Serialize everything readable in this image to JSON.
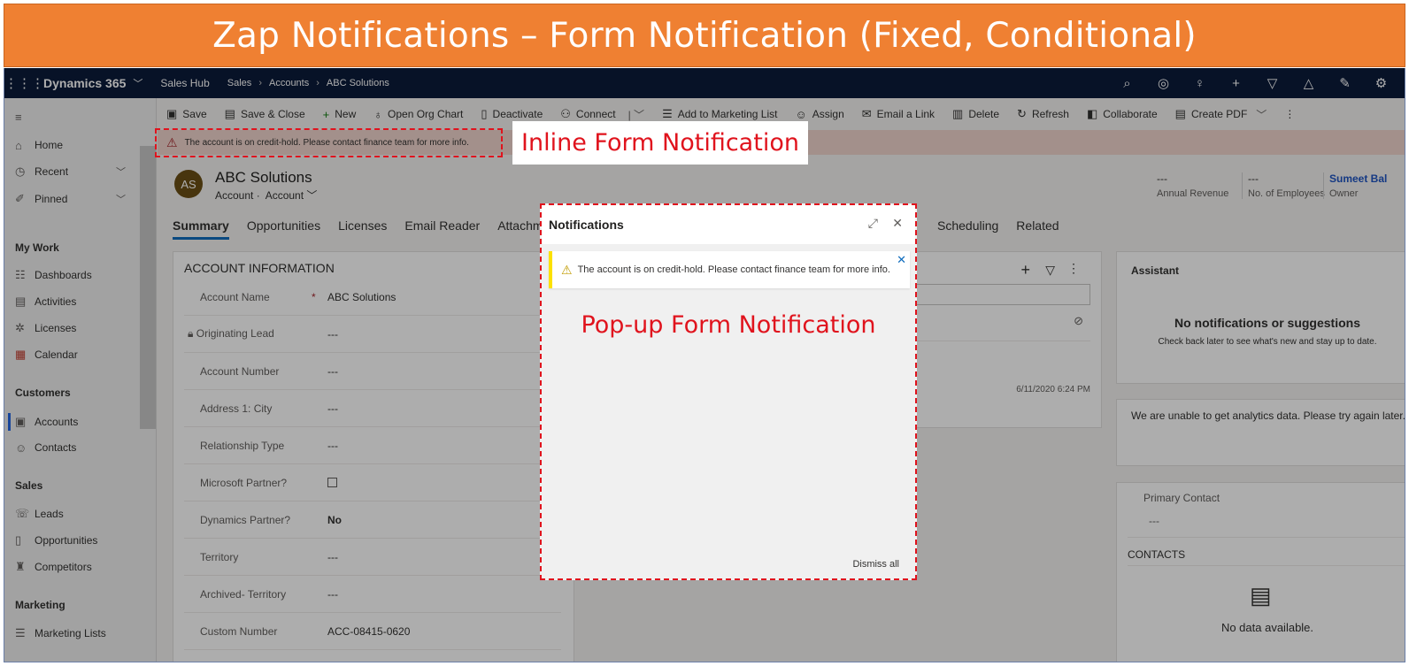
{
  "banner": {
    "title": "Zap Notifications –  Form Notification (Fixed, Conditional)"
  },
  "topbar": {
    "brand": "Dynamics 365",
    "app": "Sales Hub",
    "breadcrumb": [
      "Sales",
      "Accounts",
      "ABC Solutions"
    ]
  },
  "sidebar": {
    "home": "Home",
    "recent": "Recent",
    "pinned": "Pinned",
    "my_work": "My Work",
    "dashboards": "Dashboards",
    "activities": "Activities",
    "licenses": "Licenses",
    "calendar": "Calendar",
    "customers": "Customers",
    "accounts": "Accounts",
    "contacts": "Contacts",
    "sales": "Sales",
    "leads": "Leads",
    "opportunities": "Opportunities",
    "competitors": "Competitors",
    "marketing": "Marketing",
    "marketing_lists": "Marketing Lists"
  },
  "commands": {
    "save": "Save",
    "save_close": "Save & Close",
    "new": "New",
    "org_chart": "Open Org Chart",
    "deactivate": "Deactivate",
    "connect": "Connect",
    "add_marketing": "Add to Marketing List",
    "assign": "Assign",
    "email_link": "Email a Link",
    "delete": "Delete",
    "refresh": "Refresh",
    "collaborate": "Collaborate",
    "create_pdf": "Create PDF"
  },
  "inline_notification": {
    "text": "The account is on credit-hold. Please contact finance team for more info."
  },
  "record": {
    "initials": "AS",
    "title": "ABC Solutions",
    "entity": "Account",
    "form": "Account",
    "annual_revenue_value": "---",
    "annual_revenue_label": "Annual Revenue",
    "employees_value": "---",
    "employees_label": "No. of Employees",
    "owner_value": "Sumeet Bal",
    "owner_label": "Owner"
  },
  "tabs": [
    "Summary",
    "Opportunities",
    "Licenses",
    "Email Reader",
    "Attachment",
    "Scheduling",
    "Related"
  ],
  "account_info": {
    "title": "ACCOUNT INFORMATION",
    "fields": [
      {
        "label": "Account Name",
        "value": "ABC Solutions"
      },
      {
        "label": "Originating Lead",
        "value": "---"
      },
      {
        "label": "Account Number",
        "value": "---"
      },
      {
        "label": "Address 1: City",
        "value": "---"
      },
      {
        "label": "Relationship Type",
        "value": "---"
      },
      {
        "label": "Microsoft Partner?",
        "value": ""
      },
      {
        "label": "Dynamics Partner?",
        "value": "No"
      },
      {
        "label": "Territory",
        "value": "---"
      },
      {
        "label": "Archived- Territory",
        "value": "---"
      },
      {
        "label": "Custom Number",
        "value": "ACC-08415-0620"
      }
    ]
  },
  "timeline": {
    "timestamp": "6/11/2020 6:24 PM"
  },
  "assistant": {
    "title": "Assistant",
    "headline": "No notifications or suggestions",
    "sub": "Check back later to see what's new and stay up to date."
  },
  "analytics": {
    "message": "We are unable to get analytics data. Please try again later."
  },
  "contact_card": {
    "primary_label": "Primary Contact",
    "primary_value": "---",
    "contacts_label": "CONTACTS",
    "empty": "No data available."
  },
  "modal": {
    "title": "Notifications",
    "message": "The account is on credit-hold. Please contact finance team for more info.",
    "dismiss": "Dismiss all"
  },
  "callouts": {
    "inline": "Inline Form Notification",
    "popup": "Pop-up Form Notification"
  },
  "colors": {
    "banner": "#ef8032",
    "nav": "#0b1b3a",
    "callout": "#e0131d",
    "warning": "#fce100"
  }
}
